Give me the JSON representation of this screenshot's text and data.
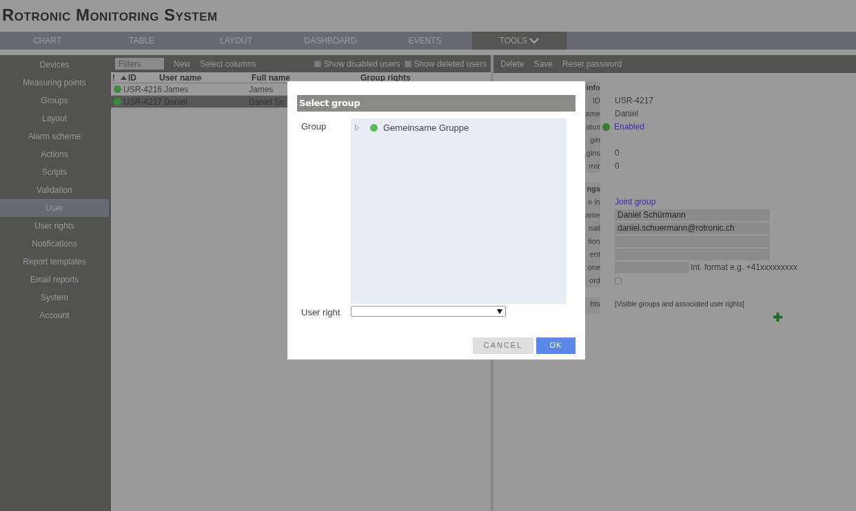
{
  "app_title": "Rotronic Monitoring System",
  "nav_tabs": [
    {
      "label": "CHART",
      "selected": false
    },
    {
      "label": "TABLE",
      "selected": false
    },
    {
      "label": "LAYOUT",
      "selected": false
    },
    {
      "label": "DASHBOARD",
      "selected": false
    },
    {
      "label": "EVENTS",
      "selected": false
    },
    {
      "label": "TOOLS",
      "selected": true,
      "dropdown": true
    }
  ],
  "sidebar": {
    "items": [
      {
        "label": "Devices",
        "selected": false
      },
      {
        "label": "Measuring points",
        "selected": false
      },
      {
        "label": "Groups",
        "selected": false
      },
      {
        "label": "Layout",
        "selected": false
      },
      {
        "label": "Alarm scheme",
        "selected": false
      },
      {
        "label": "Actions",
        "selected": false
      },
      {
        "label": "Scripts",
        "selected": false
      },
      {
        "label": "Validation",
        "selected": false
      },
      {
        "label": "User",
        "selected": true
      },
      {
        "label": "User rights",
        "selected": false
      },
      {
        "label": "Notifications",
        "selected": false
      },
      {
        "label": "Report templates",
        "selected": false
      },
      {
        "label": "Email reports",
        "selected": false
      },
      {
        "label": "System",
        "selected": false
      },
      {
        "label": "Account",
        "selected": false
      }
    ]
  },
  "user_list": {
    "filter_placeholder": "Filters",
    "actions": [
      "New",
      "Select columns"
    ],
    "toggles": [
      {
        "label": "Show disabled users",
        "checked": false
      },
      {
        "label": "Show deleted users",
        "checked": false
      }
    ],
    "columns": [
      "!",
      "ID",
      "User name",
      "Full name",
      "Group rights"
    ],
    "rows": [
      {
        "color": "#3f8a3f",
        "id": "USR-4216",
        "user_name": "James",
        "full_name": "James",
        "selected": false
      },
      {
        "color": "#3f8a3f",
        "id": "USR-4217",
        "user_name": "Daniel",
        "full_name": "Daniel Sc",
        "selected": true
      }
    ]
  },
  "detail": {
    "actions": [
      "Delete",
      "Save",
      "Reset password"
    ],
    "rows": [
      {
        "kind": "heading",
        "label": "info"
      },
      {
        "kind": "text",
        "label": "ID",
        "value": "USR-4217"
      },
      {
        "kind": "text",
        "label": "ame",
        "value": "Daniel"
      },
      {
        "kind": "status",
        "label": "atus",
        "value": "Enabled",
        "color": "#3c7a33"
      },
      {
        "kind": "text",
        "label": "gin"
      },
      {
        "kind": "text",
        "label": "gins",
        "value": "0"
      },
      {
        "kind": "text",
        "label": "rror",
        "value": "0"
      },
      {
        "kind": "heading",
        "label": "ngs"
      },
      {
        "kind": "link",
        "label": "e in",
        "value": "Joint group"
      },
      {
        "kind": "input",
        "label": "ame",
        "value": "Daniel Schürmann"
      },
      {
        "kind": "input",
        "label": "nail",
        "value": "daniel.schuermann@rotronic.ch"
      },
      {
        "kind": "input",
        "label": "tion"
      },
      {
        "kind": "input",
        "label": "ent"
      },
      {
        "kind": "phone",
        "label": "one",
        "hint": "Int. format e.g. +41xxxxxxxxx"
      },
      {
        "kind": "checkbox",
        "label": "ord",
        "checked": false
      },
      {
        "kind": "rights",
        "label": "hts",
        "note": "[Visible groups and associated user rights]"
      }
    ]
  },
  "dialog": {
    "title": "Select group",
    "group_label": "Group",
    "tree": [
      {
        "label": "Gemeinsame Gruppe",
        "expanded": false,
        "color": "#5cb85c"
      }
    ],
    "user_right_label": "User right",
    "buttons": [
      {
        "label": "CANCEL",
        "kind": "secondary"
      },
      {
        "label": "OK",
        "kind": "primary"
      }
    ]
  }
}
